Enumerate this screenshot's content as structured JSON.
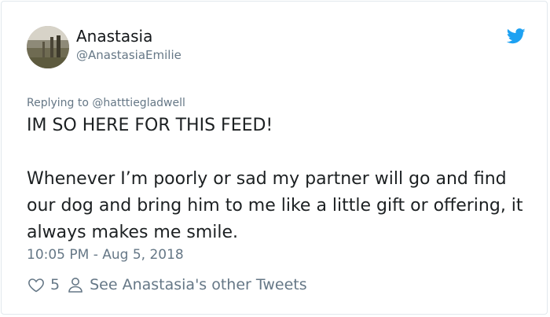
{
  "author": {
    "name": "Anastasia",
    "handle": "@AnastasiaEmilie"
  },
  "reply": {
    "label": "Replying to @hatttiegladwell"
  },
  "tweet": {
    "line1": "IM SO HERE FOR THIS FEED!",
    "line2": "Whenever I’m poorly or sad my partner will go and find our dog and bring him to me like a little gift or offering, it always makes me smile."
  },
  "timestamp": "10:05 PM - Aug 5, 2018",
  "actions": {
    "like_count": "5",
    "other_tweets_label": "See Anastasia's other Tweets"
  },
  "colors": {
    "twitter_blue": "#1da1f2",
    "secondary_text": "#657786",
    "primary_text": "#1c2022"
  },
  "icons": [
    "twitter-bird-icon",
    "heart-icon",
    "person-icon"
  ]
}
